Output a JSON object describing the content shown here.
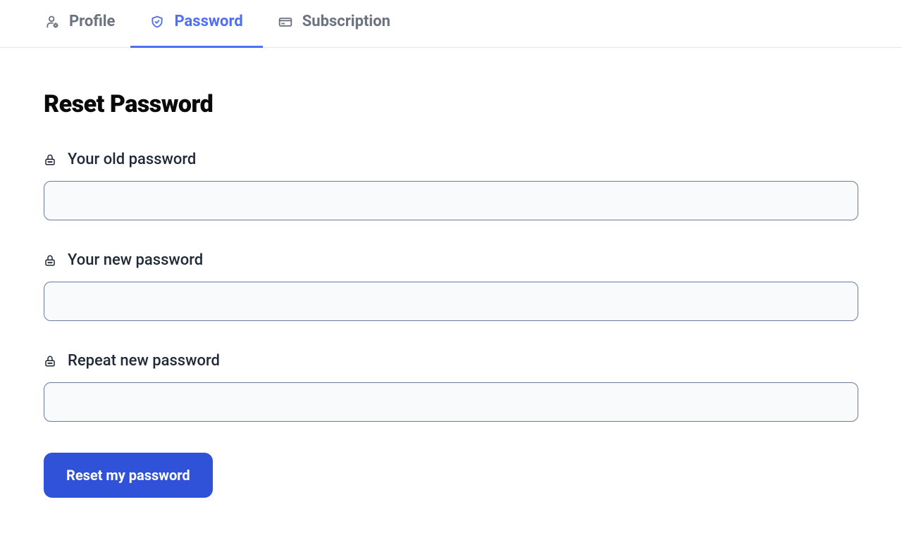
{
  "tabs": {
    "profile": {
      "label": "Profile"
    },
    "password": {
      "label": "Password"
    },
    "subscription": {
      "label": "Subscription"
    }
  },
  "page": {
    "title": "Reset Password"
  },
  "form": {
    "old_password": {
      "label": "Your old password",
      "value": ""
    },
    "new_password": {
      "label": "Your new password",
      "value": ""
    },
    "repeat_password": {
      "label": "Repeat new password",
      "value": ""
    },
    "submit_label": "Reset my password"
  }
}
